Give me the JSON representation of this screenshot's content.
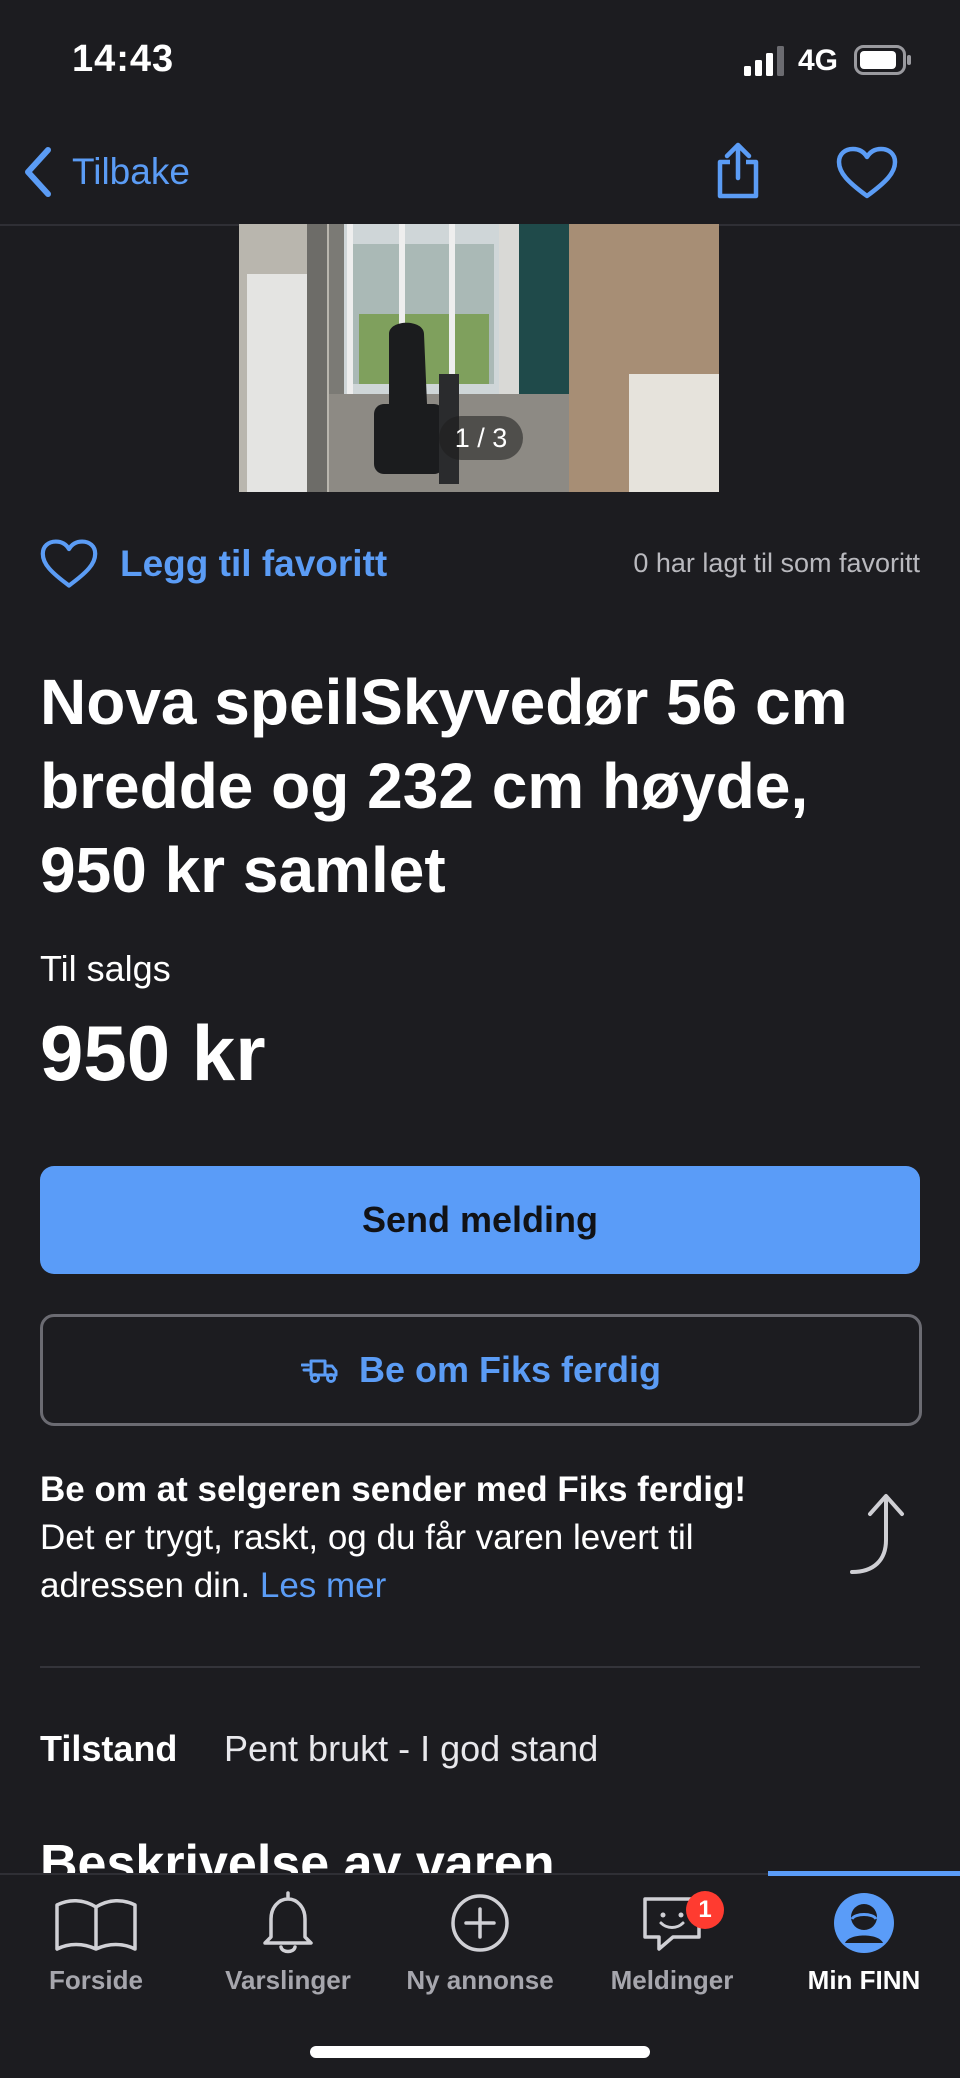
{
  "status_bar": {
    "time": "14:43",
    "network": "4G"
  },
  "nav": {
    "back_label": "Tilbake",
    "icons": [
      "chevron-left-icon",
      "share-icon",
      "heart-outline-icon"
    ]
  },
  "gallery": {
    "counter": "1 / 3"
  },
  "favorite": {
    "label": "Legg til favoritt",
    "count_text": "0 har lagt til som favoritt"
  },
  "listing": {
    "title": "Nova speilSkyvedør 56 cm bredde og 232 cm høyde, 950  kr samlet",
    "sale_type": "Til salgs",
    "price": "950 kr"
  },
  "actions": {
    "send_message": "Send melding",
    "fiks_ferdig": "Be om Fiks ferdig"
  },
  "info": {
    "title": "Be om at selgeren sender med Fiks ferdig!",
    "body": "Det er trygt, raskt, og du får varen levert til adressen din. ",
    "link": "Les mer"
  },
  "details": {
    "condition_key": "Tilstand",
    "condition_value": "Pent brukt - I god stand",
    "description_heading": "Beskrivelse av varen"
  },
  "tabs": [
    {
      "label": "Forside",
      "icon": "book-icon"
    },
    {
      "label": "Varslinger",
      "icon": "bell-icon"
    },
    {
      "label": "Ny annonse",
      "icon": "plus-circle-icon"
    },
    {
      "label": "Meldinger",
      "icon": "chat-icon",
      "badge": "1"
    },
    {
      "label": "Min FINN",
      "icon": "profile-icon",
      "active": true
    }
  ],
  "colors": {
    "background": "#1c1c20",
    "accent": "#5b9cf5",
    "primary_button": "#5a9cf8",
    "badge": "#ff3b30"
  }
}
